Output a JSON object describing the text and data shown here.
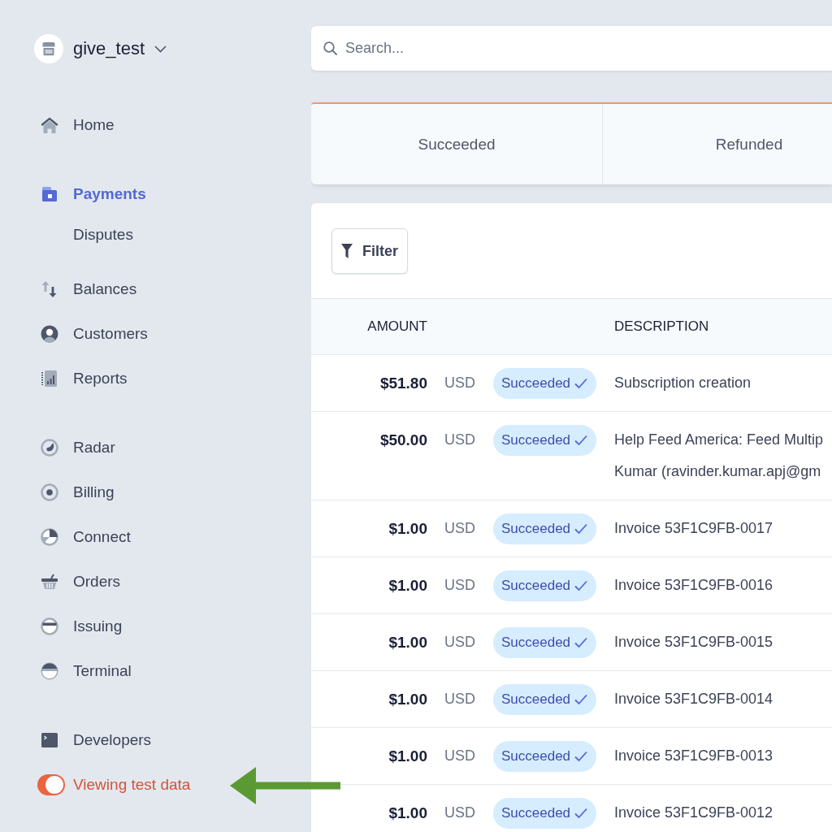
{
  "sidebar": {
    "account": {
      "name": "give_test"
    },
    "groups": [
      {
        "items": [
          {
            "label": "Home",
            "selected": false
          }
        ]
      },
      {
        "items": [
          {
            "label": "Payments",
            "selected": true,
            "children": [
              {
                "label": "Disputes",
                "selected": false
              }
            ]
          },
          {
            "label": "Balances",
            "selected": false
          },
          {
            "label": "Customers",
            "selected": false
          },
          {
            "label": "Reports",
            "selected": false
          }
        ]
      },
      {
        "items": [
          {
            "label": "Radar",
            "selected": false
          },
          {
            "label": "Billing",
            "selected": false
          },
          {
            "label": "Connect",
            "selected": false
          },
          {
            "label": "Orders",
            "selected": false
          },
          {
            "label": "Issuing",
            "selected": false
          },
          {
            "label": "Terminal",
            "selected": false
          }
        ]
      },
      {
        "items": [
          {
            "label": "Developers",
            "selected": false
          }
        ]
      }
    ],
    "test_mode": {
      "label": "Viewing test data",
      "on": true
    }
  },
  "search": {
    "placeholder": "Search..."
  },
  "status_tabs": [
    {
      "label": "Succeeded",
      "selected": false
    },
    {
      "label": "Refunded",
      "selected": false
    }
  ],
  "table": {
    "filter_button": "Filter",
    "columns": [
      "AMOUNT",
      "DESCRIPTION"
    ],
    "rows": [
      {
        "amount": "$51.80",
        "currency": "USD",
        "status": "Succeeded",
        "description": "Subscription creation"
      },
      {
        "amount": "$50.00",
        "currency": "USD",
        "status": "Succeeded",
        "description": "Help Feed America: Feed Multip\nKumar (ravinder.kumar.apj@gm"
      },
      {
        "amount": "$1.00",
        "currency": "USD",
        "status": "Succeeded",
        "description": "Invoice 53F1C9FB-0017"
      },
      {
        "amount": "$1.00",
        "currency": "USD",
        "status": "Succeeded",
        "description": "Invoice 53F1C9FB-0016"
      },
      {
        "amount": "$1.00",
        "currency": "USD",
        "status": "Succeeded",
        "description": "Invoice 53F1C9FB-0015"
      },
      {
        "amount": "$1.00",
        "currency": "USD",
        "status": "Succeeded",
        "description": "Invoice 53F1C9FB-0014"
      },
      {
        "amount": "$1.00",
        "currency": "USD",
        "status": "Succeeded",
        "description": "Invoice 53F1C9FB-0013"
      },
      {
        "amount": "$1.00",
        "currency": "USD",
        "status": "Succeeded",
        "description": "Invoice 53F1C9FB-0012"
      }
    ]
  }
}
